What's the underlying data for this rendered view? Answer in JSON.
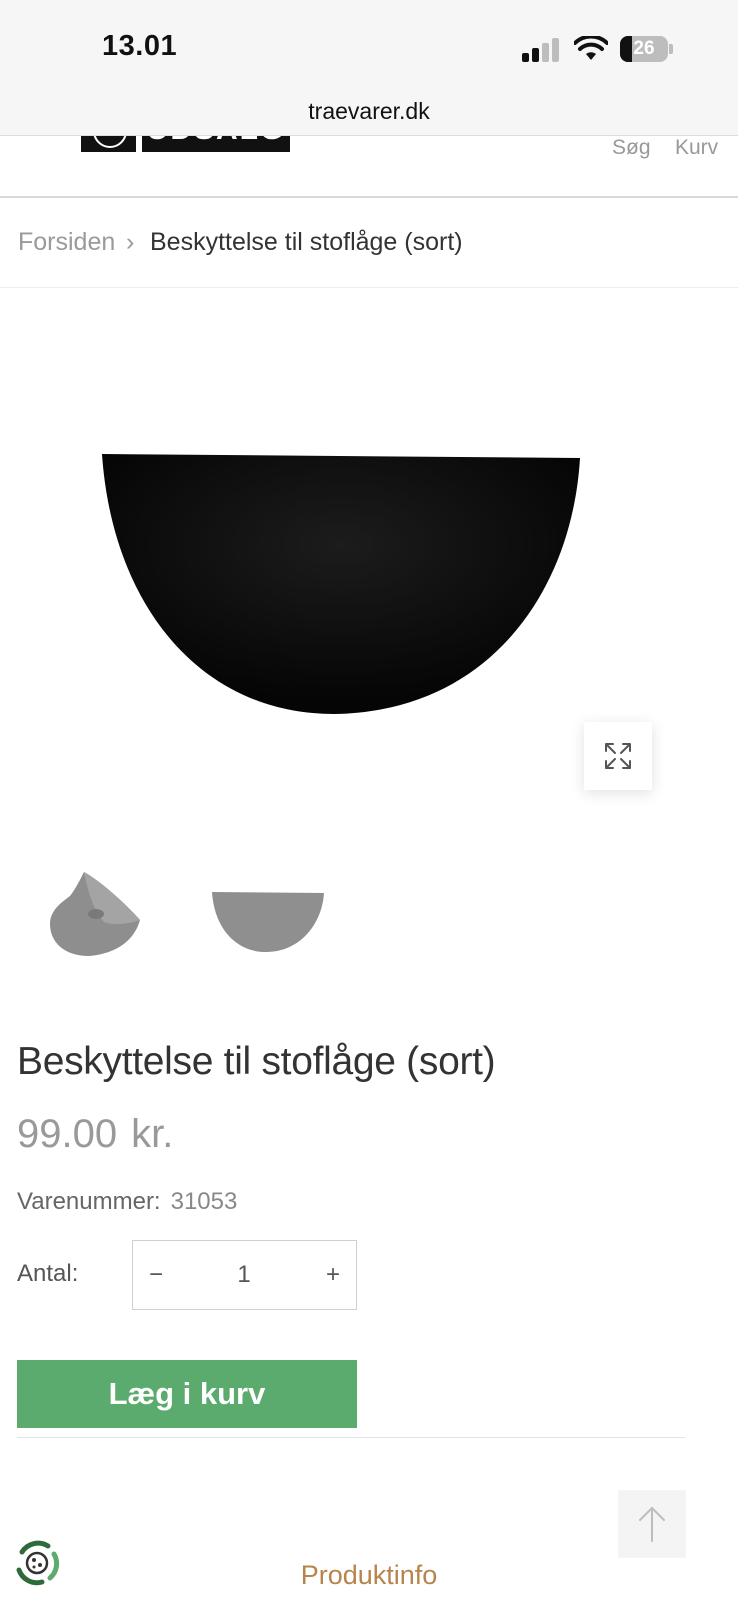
{
  "status_bar": {
    "time": "13.01",
    "battery_level": "26",
    "battery_fraction": 0.26
  },
  "browser": {
    "url": "traevarer.dk"
  },
  "header": {
    "logo_text": "UDSALG",
    "search_label": "Søg",
    "cart_label": "Kurv"
  },
  "breadcrumb": {
    "home": "Forsiden",
    "separator": "›",
    "current": "Beskyttelse til stoflåge (sort)"
  },
  "gallery": {
    "main_image_icon": "black-half-round-cover",
    "zoom_icon": "expand-icon",
    "thumbnails": [
      "thumbnail-angle-view",
      "thumbnail-front-view"
    ]
  },
  "product": {
    "title": "Beskyttelse til stoflåge (sort)",
    "price": "99.00",
    "currency": "kr.",
    "sku_label": "Varenummer:",
    "sku_value": "31053",
    "qty_label": "Antal:",
    "qty_minus": "−",
    "qty_value": "1",
    "qty_plus": "+",
    "add_to_cart": "Læg i kurv"
  },
  "footer": {
    "tab_label": "Produktinfo",
    "scroll_top_icon": "arrow-up-icon",
    "cookie_icon": "cookie-consent-icon"
  },
  "colors": {
    "add_to_cart": "#5aab6d",
    "tab_accent": "#b7844c",
    "product_black": "#0b0b0b"
  }
}
